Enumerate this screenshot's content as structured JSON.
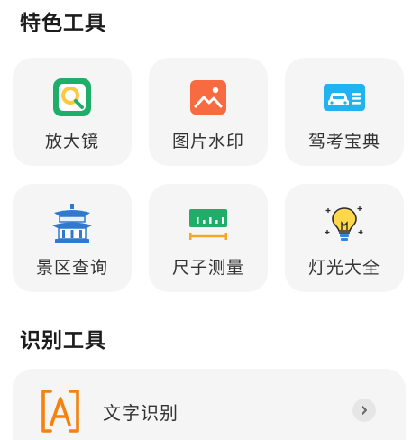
{
  "sections": {
    "featured": {
      "title": "特色工具",
      "tools": [
        {
          "label": "放大镜",
          "icon": "magnifier-icon"
        },
        {
          "label": "图片水印",
          "icon": "image-watermark-icon"
        },
        {
          "label": "驾考宝典",
          "icon": "driving-test-icon"
        },
        {
          "label": "景区查询",
          "icon": "scenic-spot-icon"
        },
        {
          "label": "尺子测量",
          "icon": "ruler-icon"
        },
        {
          "label": "灯光大全",
          "icon": "light-bulb-icon"
        }
      ]
    },
    "recognize": {
      "title": "识别工具",
      "items": [
        {
          "label": "文字识别",
          "icon": "text-recognition-icon"
        }
      ]
    }
  },
  "colors": {
    "card_bg": "#f5f5f5",
    "magnifier_green": "#1fae6a",
    "magnifier_yellow": "#ffc83d",
    "watermark_orange": "#f86a3f",
    "driving_blue": "#20b3f0",
    "scenic_blue": "#2f79d0",
    "ruler_green": "#1fae6a",
    "ruler_orange": "#f5a623",
    "bulb_yellow": "#ffd84a",
    "text_recognition_orange": "#f5820f"
  }
}
